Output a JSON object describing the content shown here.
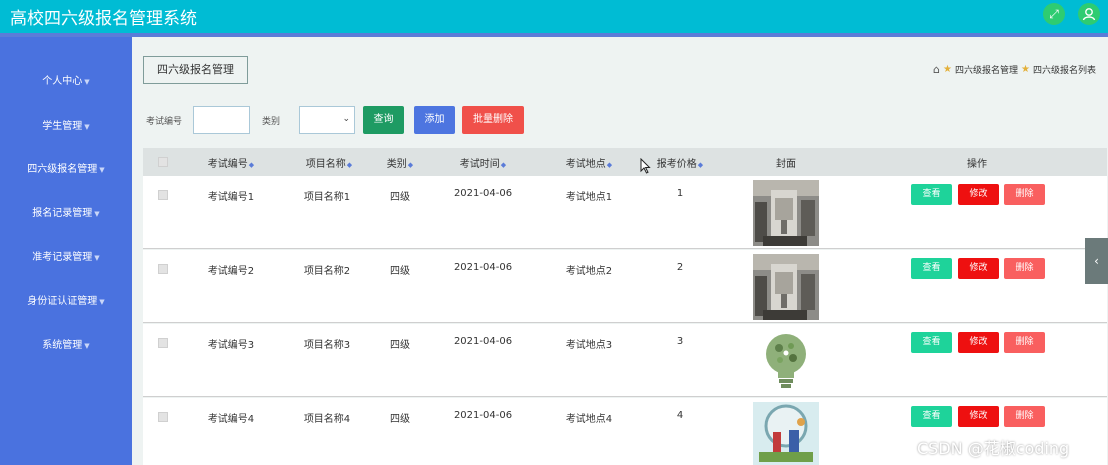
{
  "header": {
    "title": "高校四六级报名管理系统",
    "icons": [
      "fullscreen-icon",
      "user-icon"
    ]
  },
  "sidebar": {
    "items": [
      {
        "label": "个人中心"
      },
      {
        "label": "学生管理"
      },
      {
        "label": "四六级报名管理"
      },
      {
        "label": "报名记录管理"
      },
      {
        "label": "准考记录管理"
      },
      {
        "label": "身份证认证管理"
      },
      {
        "label": "系统管理"
      }
    ]
  },
  "breadcrumb": {
    "module_button": "四六级报名管理",
    "items": [
      "四六级报名管理",
      "四六级报名列表"
    ]
  },
  "search": {
    "exam_no_label": "考试编号",
    "exam_no_value": "",
    "category_label": "类别",
    "category_value": "",
    "query_button": "查询",
    "add_button": "添加",
    "batch_delete_button": "批量删除"
  },
  "table": {
    "columns": [
      "考试编号",
      "项目名称",
      "类别",
      "考试时间",
      "考试地点",
      "报考价格",
      "封面",
      "操作"
    ],
    "rows": [
      {
        "exam_no": "考试编号1",
        "project": "项目名称1",
        "category": "四级",
        "date": "2021-04-06",
        "location": "考试地点1",
        "price": "1",
        "cover": "lab-machine"
      },
      {
        "exam_no": "考试编号2",
        "project": "项目名称2",
        "category": "四级",
        "date": "2021-04-06",
        "location": "考试地点2",
        "price": "2",
        "cover": "lab-machine"
      },
      {
        "exam_no": "考试编号3",
        "project": "项目名称3",
        "category": "四级",
        "date": "2021-04-06",
        "location": "考试地点3",
        "price": "3",
        "cover": "green-lightbulb"
      },
      {
        "exam_no": "考试编号4",
        "project": "项目名称4",
        "category": "四级",
        "date": "2021-04-06",
        "location": "考试地点4",
        "price": "4",
        "cover": "lab-scene"
      }
    ],
    "actions": {
      "view": "查看",
      "edit": "修改",
      "delete": "删除"
    }
  },
  "watermark": "CSDN @花椒coding",
  "colors": {
    "header": "#00bcd4",
    "sidebar": "#4a72df",
    "query": "#1e9b63",
    "add": "#4d75e0",
    "batch_delete": "#f0504a",
    "view": "#1ed39a",
    "edit": "#ee1010",
    "delete": "#f95f5f"
  }
}
